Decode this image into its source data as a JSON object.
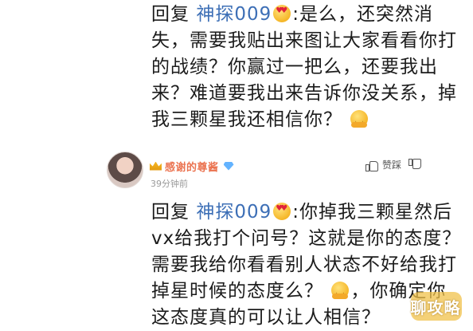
{
  "comment1": {
    "reply_prefix": "回复",
    "mention": "神探009",
    "emoji_after_mention": "heart-eyes-emoji",
    "text": ":是么，还突然消失，需要我贴出来图让大家看看你打的战绩？你赢过一把么，还要我出来？难道要我出来告诉你没关系，掉我三颗星我还相信你？",
    "emoji_end": "hug-emoji"
  },
  "comment2": {
    "username": "感谢的尊酱",
    "time": "39分钟前",
    "like_label": "赞踩",
    "reply_prefix": "回复",
    "mention": "神探009",
    "text_before_emoji": ":你掉我三颗星然后vx给我打个问号？这就是你的态度？需要我给你看看别人状态不好给我打掉星时候的态度么？",
    "text_after_emoji": "，你确定你这态度真的可以让人相信？"
  },
  "watermark": {
    "text": "聊攻略"
  },
  "colors": {
    "mention": "#3d6fb6",
    "username": "#eb7350",
    "time": "#9a9a9a"
  }
}
